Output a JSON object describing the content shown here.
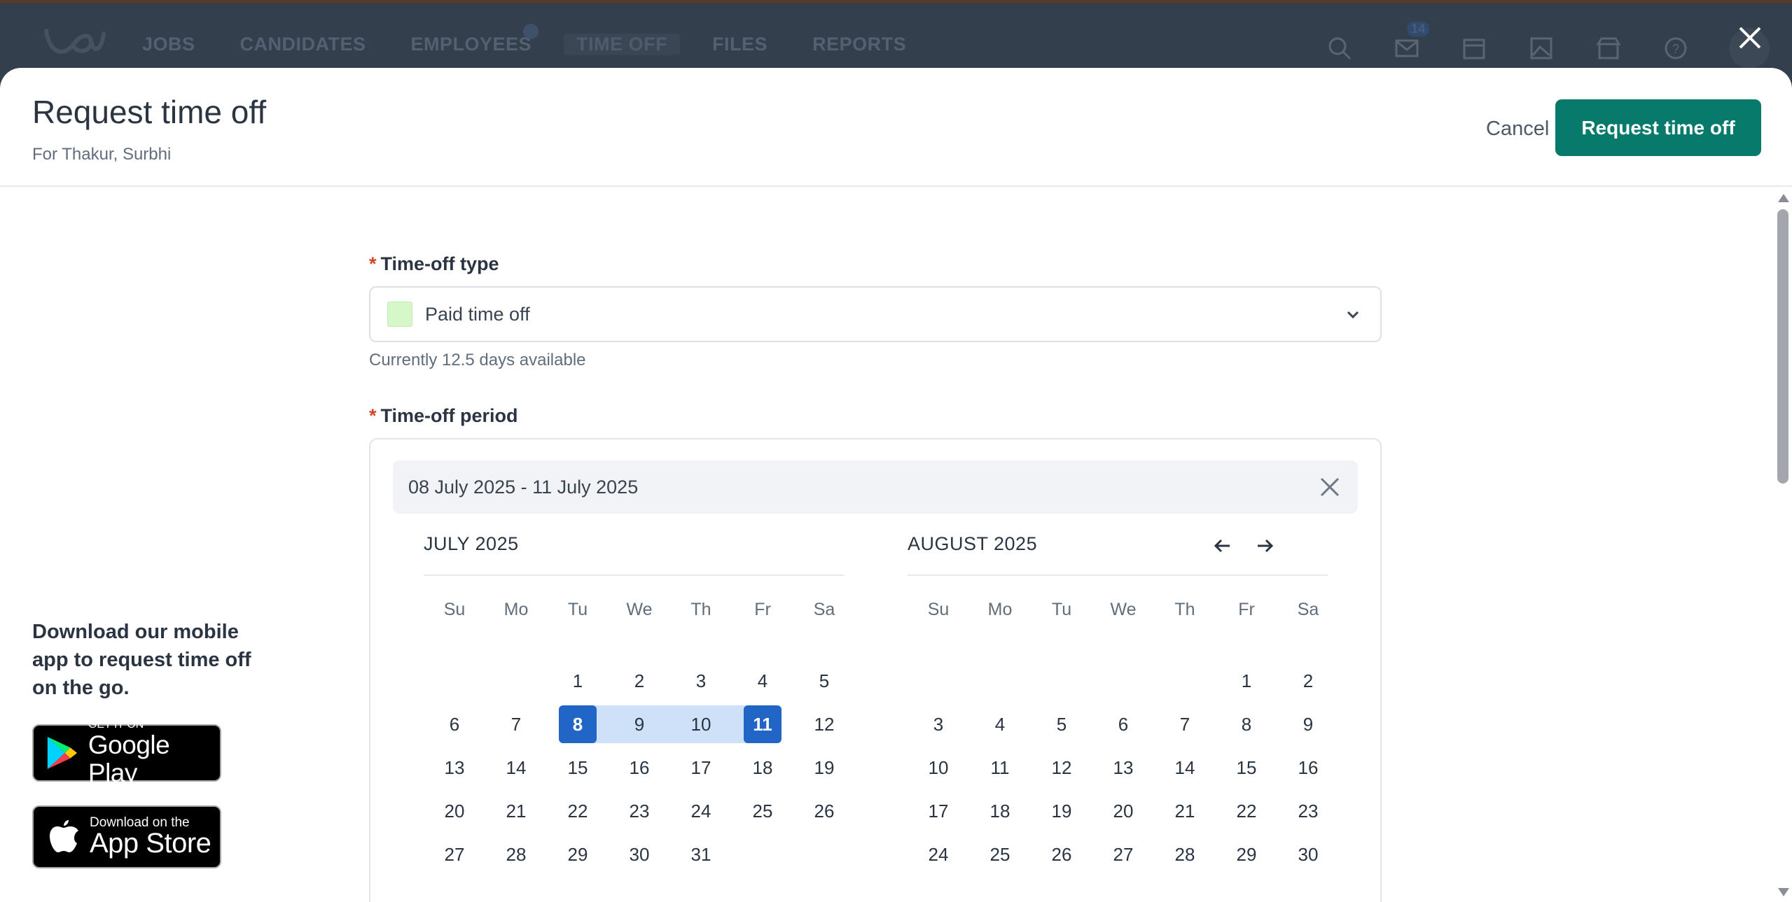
{
  "topbar": {
    "nav": [
      {
        "label": "JOBS",
        "active": false
      },
      {
        "label": "CANDIDATES",
        "active": false
      },
      {
        "label": "EMPLOYEES",
        "active": false
      },
      {
        "label": "TIME OFF",
        "active": true
      },
      {
        "label": "FILES",
        "active": false
      },
      {
        "label": "REPORTS",
        "active": false
      }
    ],
    "inbox_badge": "14",
    "icons": [
      "search-icon",
      "inbox-icon",
      "calendar-icon",
      "image-icon",
      "store-icon",
      "help-icon"
    ]
  },
  "modal": {
    "title": "Request time off",
    "subtitle": "For Thakur, Surbhi",
    "cancel_label": "Cancel",
    "submit_label": "Request time off"
  },
  "promo": {
    "text": "Download our mobile app to request time off on the go.",
    "google_small": "GET IT ON",
    "google_big": "Google Play",
    "apple_small": "Download on the",
    "apple_big": "App Store"
  },
  "form": {
    "type_label": "Time-off type",
    "type_value": "Paid time off",
    "type_color": "#d6f8c8",
    "availability": "Currently 12.5 days available",
    "period_label": "Time-off period",
    "period_value": "08 July 2025 - 11 July 2025"
  },
  "calendar": {
    "weekdays": [
      "Su",
      "Mo",
      "Tu",
      "We",
      "Th",
      "Fr",
      "Sa"
    ],
    "months": [
      {
        "title": "JULY 2025",
        "offset": 2,
        "days": 31,
        "range_start": 8,
        "range_end": 11
      },
      {
        "title": "AUGUST 2025",
        "offset": 5,
        "days": 30,
        "range_start": null,
        "range_end": null
      }
    ]
  },
  "colors": {
    "primary": "#087a6b",
    "selected": "#2166c7",
    "range": "#cfe1f8",
    "required": "#d64226"
  }
}
